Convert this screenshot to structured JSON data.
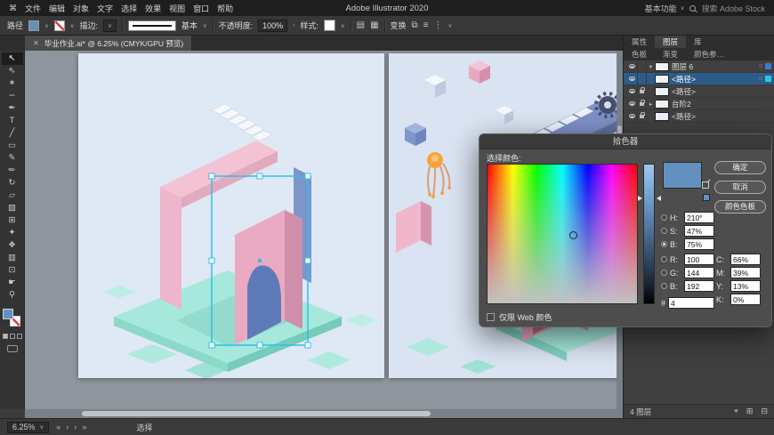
{
  "icons": {
    "apple": "⌘",
    "caret": "∨",
    "close": "✕",
    "chevron": "›",
    "doc_setup": "▤",
    "grid": "▦",
    "arrange": "⧉",
    "align": "≡",
    "dots": "⋮",
    "first": "«",
    "prev": "‹",
    "next": "›",
    "last": "»",
    "expand_open": "▾",
    "expand_closed": "▸",
    "target": "○",
    "locate": "⌖",
    "new_layer": "⊞",
    "delete_layer": "⊟"
  },
  "menu_bar": {
    "items": [
      "文件",
      "编辑",
      "对象",
      "文字",
      "选择",
      "效果",
      "视图",
      "窗口",
      "帮助"
    ],
    "title": "Adobe Illustrator 2020",
    "workspace": "基本功能",
    "search": "搜索 Adobe Stock"
  },
  "control_bar": {
    "target_label": "路径",
    "stroke_label": "描边:",
    "brush_name": "基本",
    "opacity_label": "不透明度:",
    "opacity_value": "100%",
    "style_label": "样式:",
    "transform_label": "变换"
  },
  "document_tab": {
    "title": "毕业作业.ai* @ 6.25% (CMYK/GPU 预览)"
  },
  "toolbar": {
    "tools": [
      {
        "name": "selection",
        "glyph": "↖"
      },
      {
        "name": "direct-selection",
        "glyph": "⇖"
      },
      {
        "name": "magic-wand",
        "glyph": "✶"
      },
      {
        "name": "lasso",
        "glyph": "∽"
      },
      {
        "name": "pen",
        "glyph": "✒"
      },
      {
        "name": "type",
        "glyph": "T"
      },
      {
        "name": "line",
        "glyph": "╱"
      },
      {
        "name": "rectangle",
        "glyph": "▭"
      },
      {
        "name": "paintbrush",
        "glyph": "✎"
      },
      {
        "name": "pencil",
        "glyph": "✏"
      },
      {
        "name": "rotate",
        "glyph": "↻"
      },
      {
        "name": "scale",
        "glyph": "▱"
      },
      {
        "name": "gradient",
        "glyph": "▨"
      },
      {
        "name": "mesh",
        "glyph": "⊞"
      },
      {
        "name": "eyedropper",
        "glyph": "✦"
      },
      {
        "name": "blend",
        "glyph": "❖"
      },
      {
        "name": "graph",
        "glyph": "▥"
      },
      {
        "name": "artboard",
        "glyph": "⊡"
      },
      {
        "name": "hand",
        "glyph": "☛"
      },
      {
        "name": "zoom",
        "glyph": "⚲"
      }
    ]
  },
  "right_panel": {
    "tabs_row1": [
      "属性",
      "图层",
      "库"
    ],
    "tabs_row2": [
      "色板",
      "渐变",
      "颜色参…"
    ],
    "layers": [
      {
        "name": "图层 6"
      },
      {
        "name": "<路径>"
      },
      {
        "name": "<路径>"
      },
      {
        "name": "台阶2"
      },
      {
        "name": "<路径>"
      }
    ],
    "footer_count": "4 图层"
  },
  "color_picker": {
    "title": "拾色器",
    "prompt": "选择颜色:",
    "ok": "确定",
    "cancel": "取消",
    "swatches": "颜色色板",
    "channels_left": [
      {
        "label": "H:",
        "value": "210°"
      },
      {
        "label": "S:",
        "value": "47%"
      },
      {
        "label": "B:",
        "value": "75%"
      },
      {
        "label": "R:",
        "value": "100"
      },
      {
        "label": "G:",
        "value": "144"
      },
      {
        "label": "B:",
        "value": "192"
      }
    ],
    "channels_right": [
      {
        "label": "C:",
        "value": "66%"
      },
      {
        "label": "M:",
        "value": "39%"
      },
      {
        "label": "Y:",
        "value": "13%"
      },
      {
        "label": "K:",
        "value": "0%"
      }
    ],
    "hex_label": "#",
    "hex_value": "4",
    "web_only": "仅限 Web 颜色",
    "current_color": "#6490C0"
  },
  "status_bar": {
    "zoom": "6.25%",
    "tool": "选择"
  },
  "colors": {
    "picker_blue": "#6490C0",
    "selection_cyan": "#2FC0EA"
  }
}
